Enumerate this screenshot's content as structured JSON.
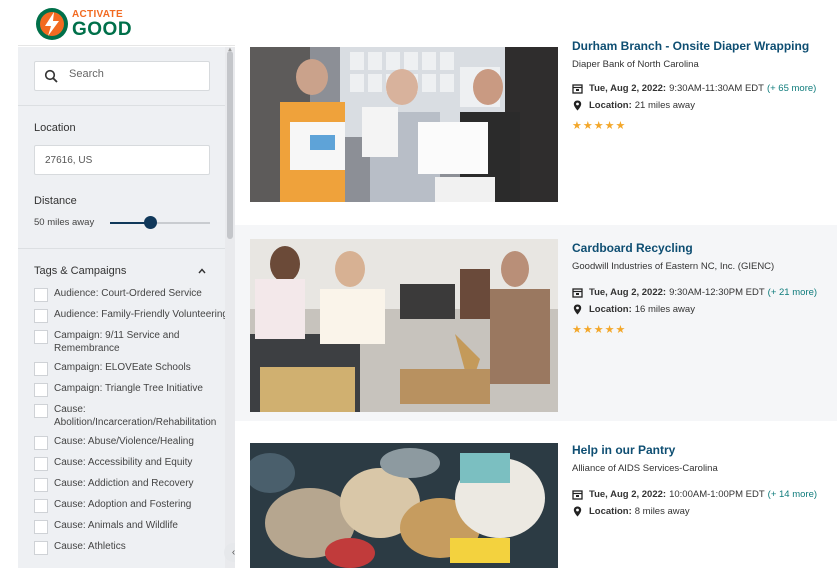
{
  "brand": {
    "top": "ACTIVATE",
    "bottom": "GOOD"
  },
  "sidebar": {
    "search_placeholder": "Search",
    "location_label": "Location",
    "location_value": "27616, US",
    "distance_label": "Distance",
    "distance_value": "50 miles away",
    "distance_level_percent": 40,
    "tags_label": "Tags & Campaigns",
    "tags": [
      "Audience: Court-Ordered Service",
      "Audience: Family-Friendly Volunteering",
      "Campaign: 9/11 Service and Remembrance",
      "Campaign: ELOVEate Schools",
      "Campaign: Triangle Tree Initiative",
      "Cause: Abolition/Incarceration/Rehabilitation",
      "Cause: Abuse/Violence/Healing",
      "Cause: Accessibility and Equity",
      "Cause: Addiction and Recovery",
      "Cause: Adoption and Fostering",
      "Cause: Animals and Wildlife",
      "Cause: Athletics"
    ]
  },
  "results": [
    {
      "title": "Durham Branch - Onsite Diaper Wrapping",
      "org": "Diaper Bank of North Carolina",
      "date": "Tue, Aug 2, 2022:",
      "time": "9:30AM-11:30AM EDT",
      "more": "(+ 65 more)",
      "location_label": "Location:",
      "location": "21 miles away",
      "rating": "★★★★★"
    },
    {
      "title": "Cardboard Recycling",
      "org": "Goodwill Industries of Eastern NC, Inc. (GIENC)",
      "date": "Tue, Aug 2, 2022:",
      "time": "9:30AM-12:30PM EDT",
      "more": "(+ 21 more)",
      "location_label": "Location:",
      "location": "16 miles away",
      "rating": "★★★★★"
    },
    {
      "title": "Help in our Pantry",
      "org": "Alliance of AIDS Services-Carolina",
      "date": "Tue, Aug 2, 2022:",
      "time": "10:00AM-1:00PM EDT",
      "more": "(+ 14 more)",
      "location_label": "Location:",
      "location": "8 miles away"
    }
  ],
  "colors": {
    "accent": "#0e4e72",
    "link": "#0f7c7c",
    "star": "#f3a72a",
    "brand_orange": "#f26a21",
    "brand_green": "#00704a"
  }
}
